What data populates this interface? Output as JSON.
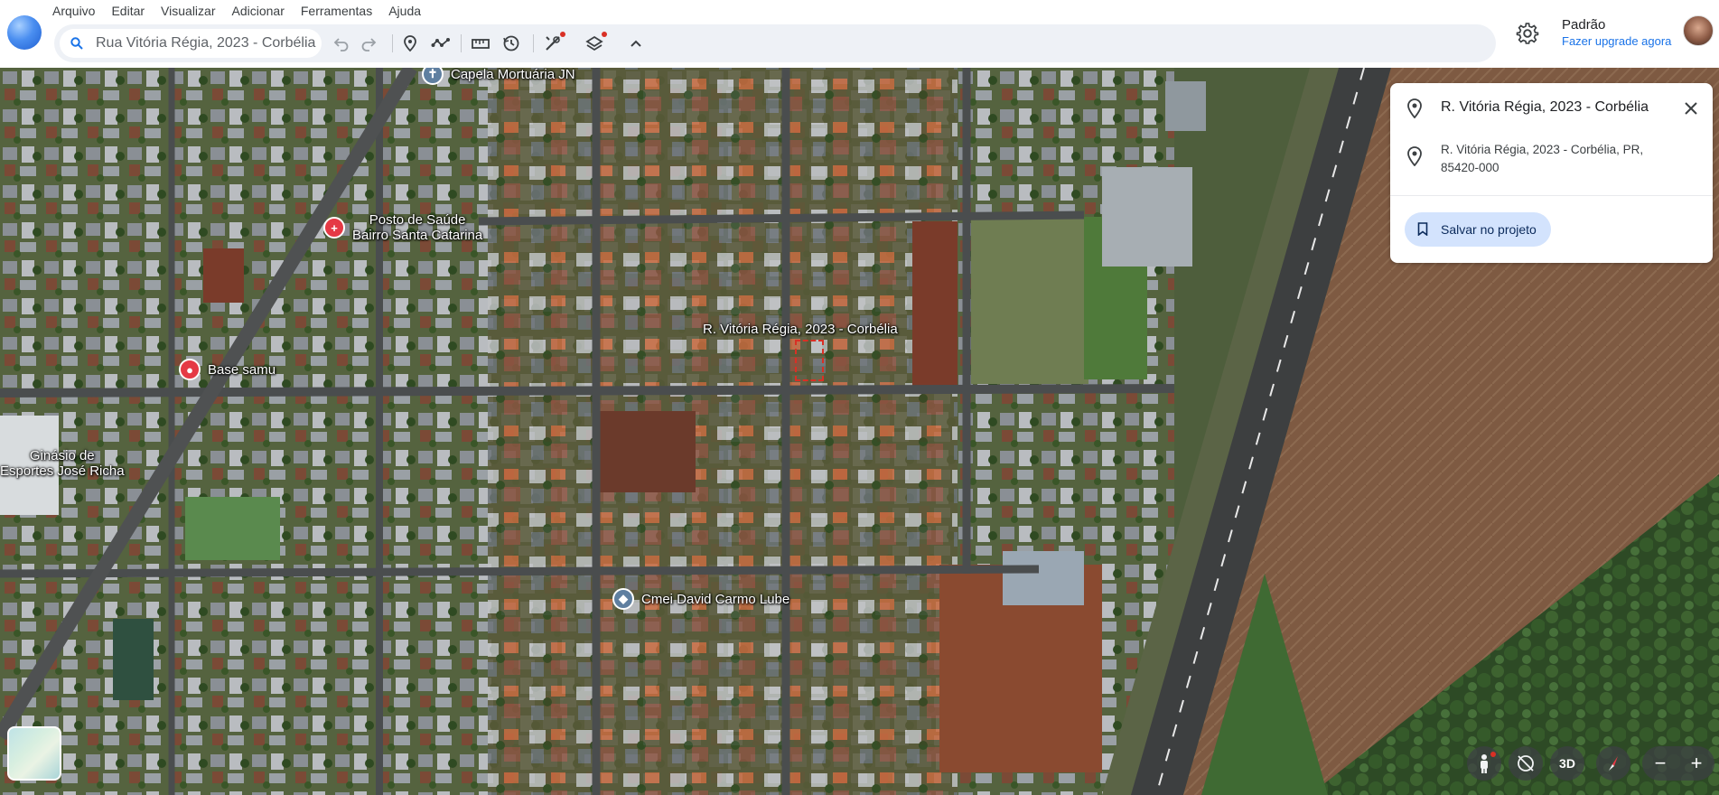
{
  "menu": {
    "items": [
      "Arquivo",
      "Editar",
      "Visualizar",
      "Adicionar",
      "Ferramentas",
      "Ajuda"
    ]
  },
  "toolbar": {
    "search_value": "Rua Vitória Régia, 2023 - Corbélia",
    "icons": [
      "undo-icon",
      "redo-icon",
      "placemark-icon",
      "path-icon",
      "ruler-icon",
      "history-icon",
      "tools-icon",
      "layers-icon",
      "collapse-icon"
    ]
  },
  "account": {
    "name": "Padrão",
    "upgrade": "Fazer upgrade agora"
  },
  "map": {
    "pois": [
      {
        "name": "Capela Mortuária JN",
        "type": "chapel"
      },
      {
        "name": "Posto de Saúde\nBairro Santa Catarina",
        "type": "health"
      },
      {
        "name": "Base samu",
        "type": "health"
      },
      {
        "name": "Cmei David Carmo Lube",
        "type": "school"
      }
    ],
    "labels": {
      "target": "R. Vitória Régia, 2023 - Corbélia",
      "gym": "Ginásio de\nEsportes José Richa"
    }
  },
  "panel": {
    "title": "R. Vitória Régia, 2023 - Corbélia",
    "address": "R. Vitória Régia, 2023 - Corbélia, PR, 85420-000",
    "save_label": "Salvar no projeto"
  },
  "controls": {
    "view_3d": "3D",
    "zoom_out": "−",
    "zoom_in": "+"
  },
  "colors": {
    "accent": "#1a73e8",
    "save_bg": "#d3e3fd",
    "marker_red": "#d93025"
  }
}
